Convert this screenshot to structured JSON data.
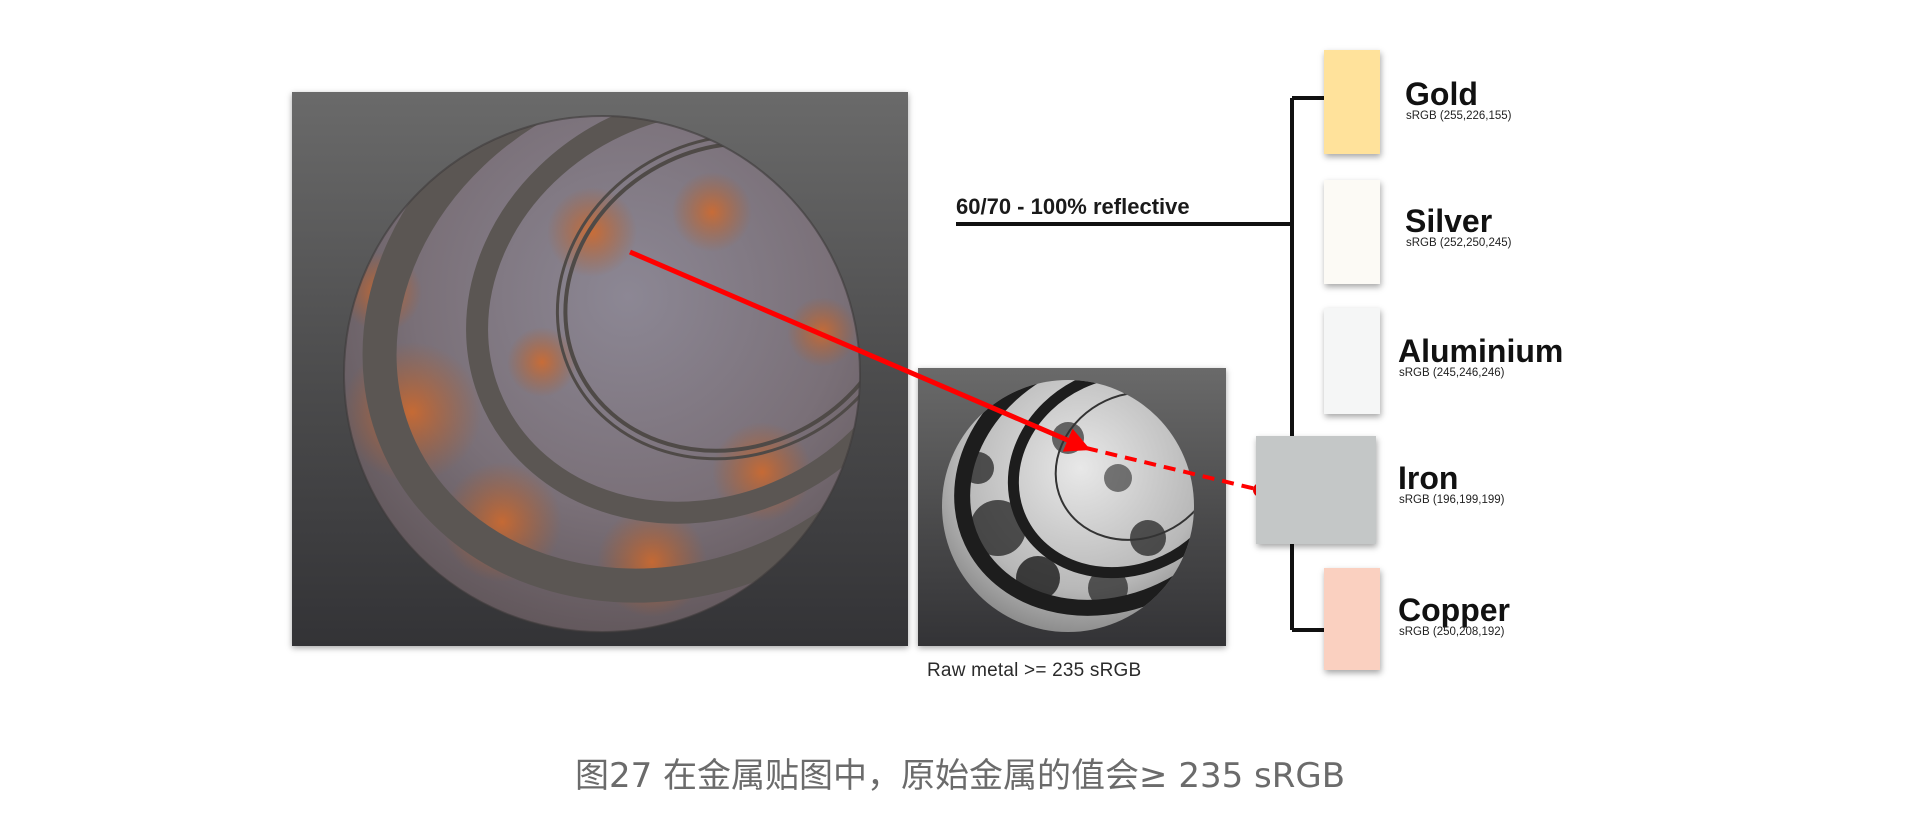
{
  "reflective_label": "60/70 - 100% reflective",
  "raw_metal_caption": "Raw metal >= 235 sRGB",
  "figure_caption": "图27 在金属贴图中，原始金属的值会≥ 235 sRGB",
  "metals": [
    {
      "name": "Gold",
      "srgb": "sRGB (255,226,155)",
      "color": "#ffe29b"
    },
    {
      "name": "Silver",
      "srgb": "sRGB (252,250,245)",
      "color": "#fcfaf5"
    },
    {
      "name": "Aluminium",
      "srgb": "sRGB (245,246,246)",
      "color": "#f5f6f6"
    },
    {
      "name": "Iron",
      "srgb": "sRGB (196,199,199)",
      "color": "#c4c7c7"
    },
    {
      "name": "Copper",
      "srgb": "sRGB (250,208,192)",
      "color": "#fad0c0"
    }
  ],
  "colors": {
    "arrow": "#ff0000",
    "connector": "#111111",
    "panel_background": "#4f4f50"
  }
}
